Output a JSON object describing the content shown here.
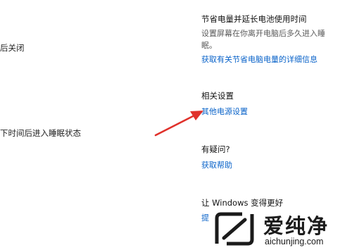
{
  "left": {
    "line1": "后关闭",
    "line2": "下时间后进入睡眠状态"
  },
  "sections": {
    "power_saving": {
      "heading": "节省电量并延长电池使用时间",
      "description": "设置屏幕在你离开电脑后多久进入睡眠。",
      "link": "获取有关节省电脑电量的详细信息"
    },
    "related": {
      "heading": "相关设置",
      "link": "其他电源设置"
    },
    "questions": {
      "heading": "有疑问?",
      "link": "获取帮助"
    },
    "improve": {
      "heading": "让 Windows 变得更好",
      "link": "提"
    }
  },
  "annotation": {
    "arrow_color": "#e0312b"
  },
  "watermark": {
    "brand": "爱纯净",
    "domain": "aichunjing.com"
  },
  "colors": {
    "link": "#0a63c9",
    "heading": "#111111",
    "body": "#5a5a5a"
  }
}
